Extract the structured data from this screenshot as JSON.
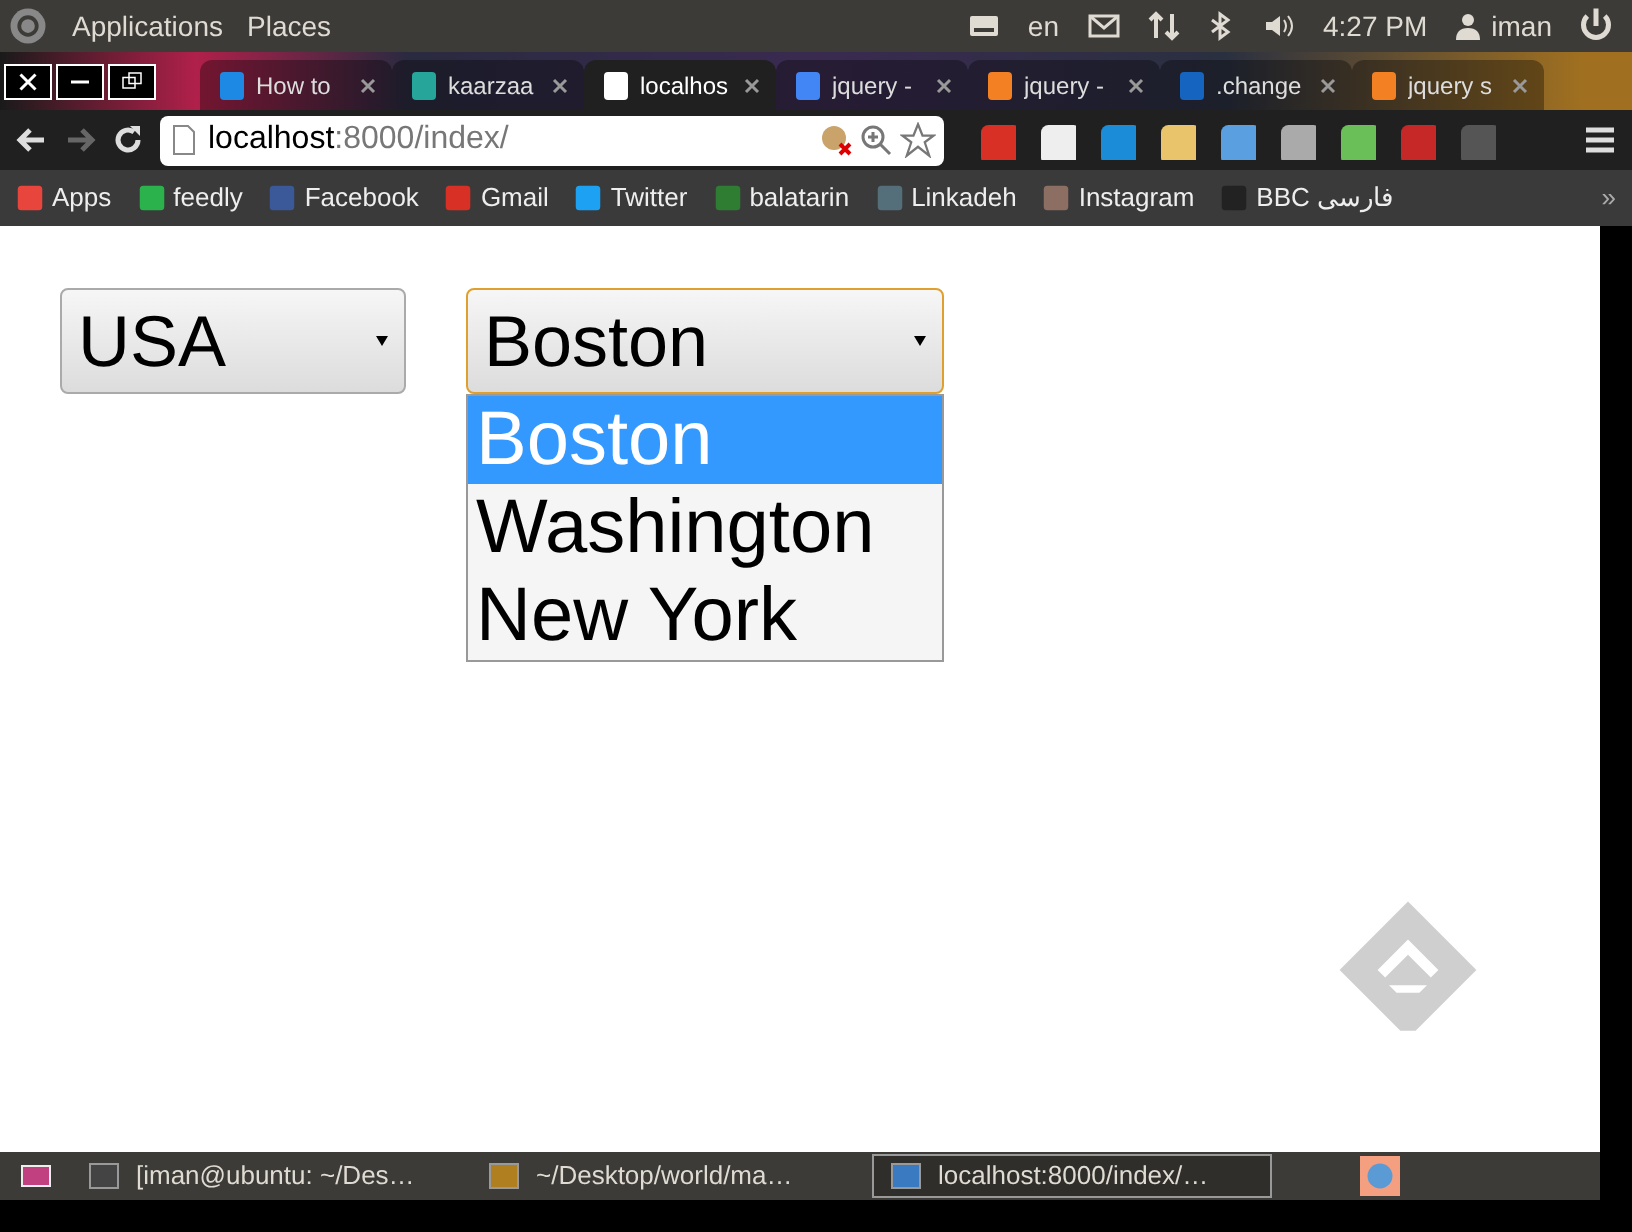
{
  "top_panel": {
    "menus": [
      "Applications",
      "Places"
    ],
    "language": "en",
    "time": "4:27 PM",
    "user": "iman"
  },
  "tabs": [
    {
      "label": "How to",
      "selected": false
    },
    {
      "label": "kaarzaa",
      "selected": false
    },
    {
      "label": "localhos",
      "selected": true
    },
    {
      "label": "jquery -",
      "selected": false
    },
    {
      "label": "jquery -",
      "selected": false
    },
    {
      "label": ".change",
      "selected": false
    },
    {
      "label": "jquery s",
      "selected": false
    }
  ],
  "address": {
    "host": "localhost",
    "path": ":8000/index/"
  },
  "bookmarks": [
    {
      "label": "Apps"
    },
    {
      "label": "feedly"
    },
    {
      "label": "Facebook"
    },
    {
      "label": "Gmail"
    },
    {
      "label": "Twitter"
    },
    {
      "label": "balatarin"
    },
    {
      "label": "Linkadeh"
    },
    {
      "label": "Instagram"
    },
    {
      "label": "BBC فارسی"
    }
  ],
  "bookmarks_overflow": "»",
  "country_select": {
    "value": "USA"
  },
  "city_select": {
    "value": "Boston",
    "expanded": true,
    "options": [
      {
        "label": "Boston",
        "selected": true
      },
      {
        "label": "Washington",
        "selected": false
      },
      {
        "label": "New York",
        "selected": false
      }
    ]
  },
  "taskbar": [
    {
      "label": "[iman@ubuntu: ~/Des…",
      "selected": false
    },
    {
      "label": "~/Desktop/world/ma…",
      "selected": false
    },
    {
      "label": "localhost:8000/index/…",
      "selected": true
    }
  ]
}
